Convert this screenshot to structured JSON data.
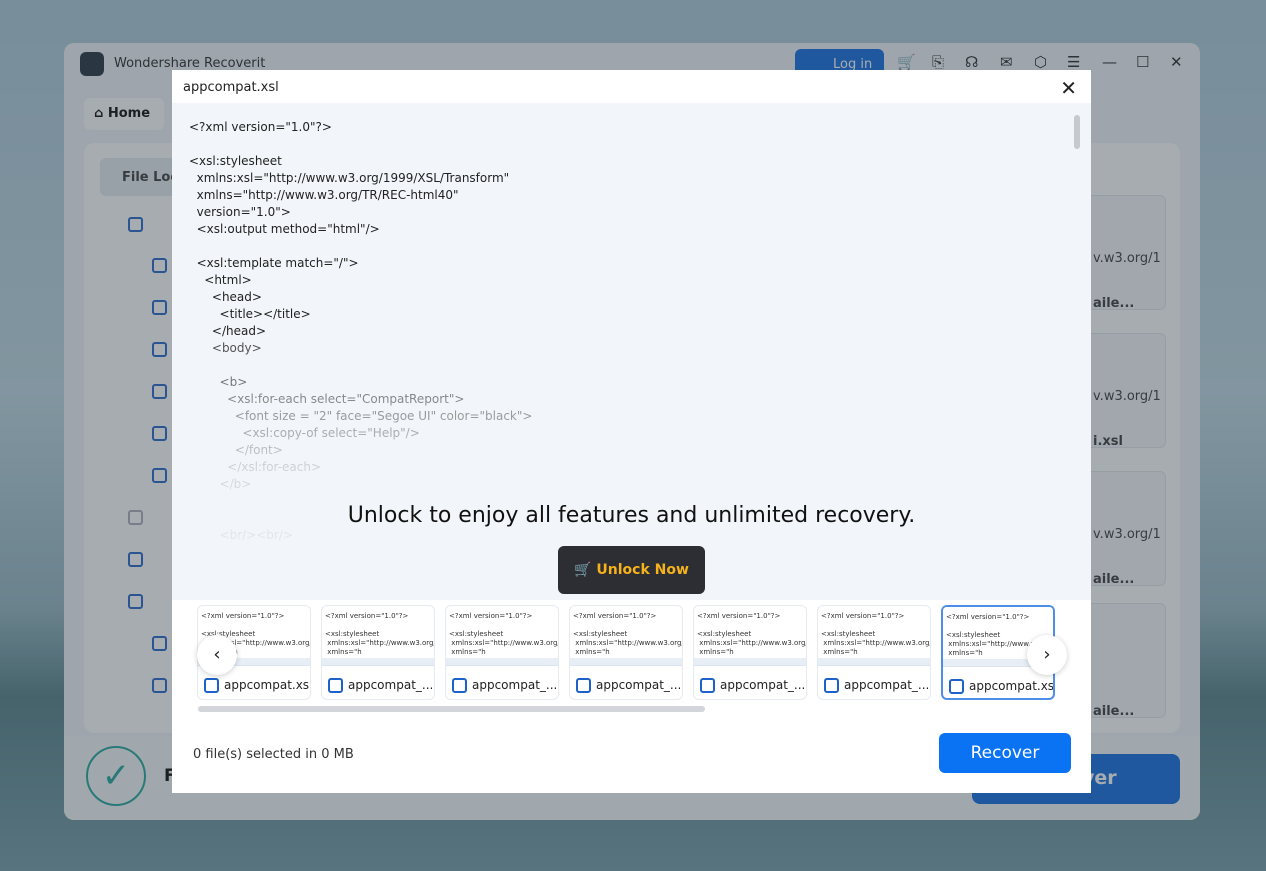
{
  "app": {
    "title": "Wondershare Recoverit",
    "login_label": "Log in",
    "home_label": "Home",
    "file_location_tab": "File Loc",
    "bottom_recover_label": "ver",
    "bottom_status": "F",
    "right_cards": [
      "aile...",
      "i.xsl",
      "aile...",
      "aile..."
    ],
    "right_card_url": "v.w3.org/1"
  },
  "modal": {
    "title": "appcompat.xsl",
    "code": "<?xml version=\"1.0\"?>\n\n<xsl:stylesheet\n  xmlns:xsl=\"http://www.w3.org/1999/XSL/Transform\"\n  xmlns=\"http://www.w3.org/TR/REC-html40\"\n  version=\"1.0\">\n  <xsl:output method=\"html\"/>\n\n  <xsl:template match=\"/\">\n    <html>\n      <head>\n        <title></title>\n      </head>\n      <body>\n\n        <b>\n          <xsl:for-each select=\"CompatReport\">\n            <font size = \"2\" face=\"Segoe UI\" color=\"black\">\n              <xsl:copy-of select=\"Help\"/>\n            </font>\n          </xsl:for-each>\n        </b>\n\n\n        <br/><br/>",
    "unlock_text": "Unlock to enjoy all features and unlimited recovery.",
    "unlock_button": "Unlock Now",
    "thumb_preview": "<?xml version=\"1.0\"?>\n\n<xsl:stylesheet\n xmlns:xsl=\"http://www.w3.org/1\n xmlns=\"h",
    "thumbnails": [
      {
        "label": "appcompat.xsl"
      },
      {
        "label": "appcompat_..."
      },
      {
        "label": "appcompat_..."
      },
      {
        "label": "appcompat_..."
      },
      {
        "label": "appcompat_..."
      },
      {
        "label": "appcompat_..."
      },
      {
        "label": "appcompat.xsl",
        "selected": true
      }
    ],
    "selection_status": "0 file(s) selected in 0 MB",
    "recover_button": "Recover"
  },
  "colors": {
    "accent": "#0a73f4",
    "unlock_text": "#f6b21a"
  }
}
